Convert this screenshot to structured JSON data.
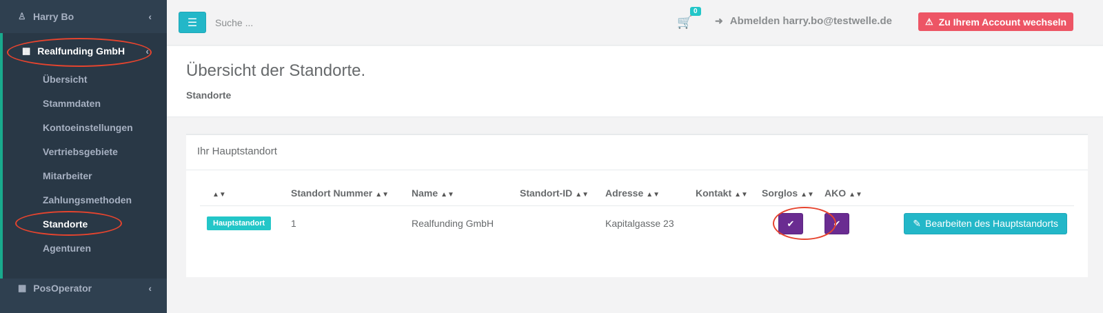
{
  "sidebar": {
    "user_name": "Harry Bo",
    "company": "Realfunding GmbH",
    "items": [
      {
        "label": "Übersicht"
      },
      {
        "label": "Stammdaten"
      },
      {
        "label": "Kontoeinstellungen"
      },
      {
        "label": "Vertriebsgebiete"
      },
      {
        "label": "Mitarbeiter"
      },
      {
        "label": "Zahlungsmethoden"
      },
      {
        "label": "Standorte"
      },
      {
        "label": "Agenturen"
      }
    ],
    "active_item": "Standorte",
    "second_company": "PosOperator"
  },
  "topbar": {
    "search_placeholder": "Suche ...",
    "cart_count": "0",
    "logout_label": "Abmelden harry.bo@testwelle.de",
    "switch_label": "Zu Ihrem Account wechseln"
  },
  "page": {
    "title": "Übersicht der Standorte.",
    "breadcrumb": "Standorte"
  },
  "box": {
    "title": "Ihr Hauptstandort",
    "columns": [
      "",
      "Standort Nummer",
      "Name",
      "Standort-ID",
      "Adresse",
      "Kontakt",
      "Sorglos",
      "AKO"
    ],
    "row": {
      "badge": "Hauptstandort",
      "number": "1",
      "name": "Realfunding GmbH",
      "standort_id": "",
      "address": "Kapitalgasse 23",
      "contact": "",
      "sorglos": true,
      "ako": true
    },
    "edit_button": "Bearbeiten des Hauptstandorts"
  },
  "colors": {
    "sidebar_bg": "#2f4050",
    "accent_cyan": "#23b7c8",
    "danger": "#ed5565",
    "purple": "#6a2c91",
    "annotation": "#e6442e"
  }
}
